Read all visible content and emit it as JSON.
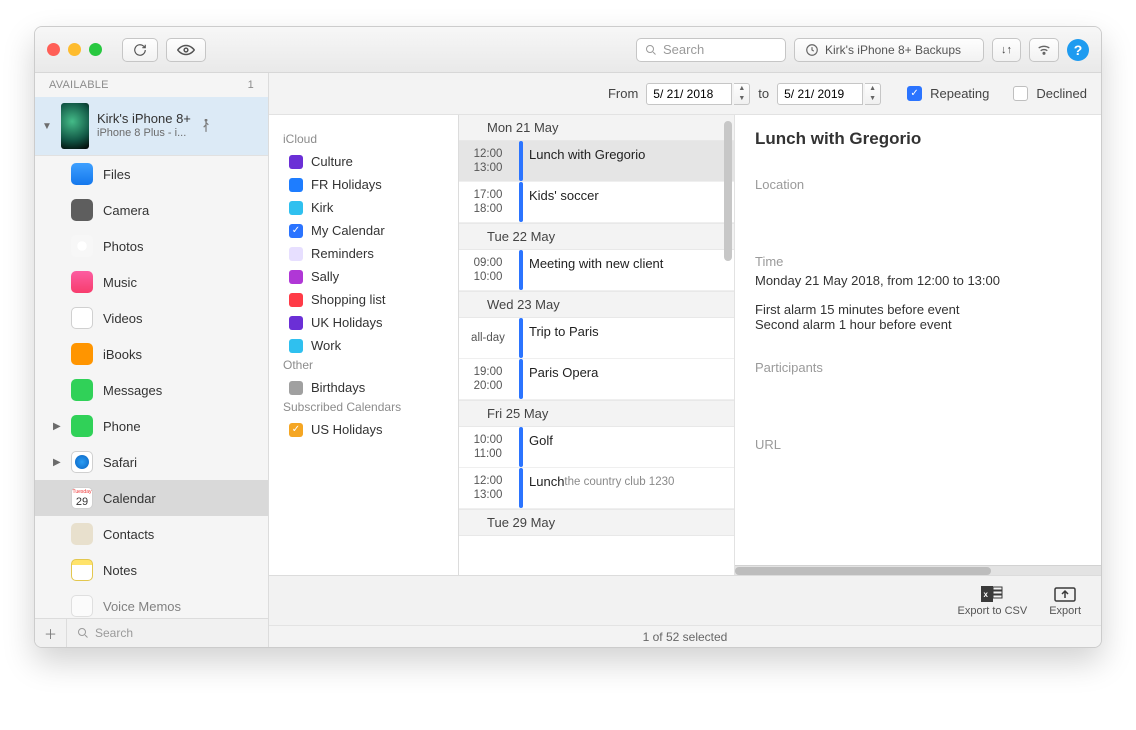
{
  "toolbar": {
    "search_placeholder": "Search",
    "backups_label": "Kirk's iPhone 8+ Backups"
  },
  "sidebar": {
    "header": "AVAILABLE",
    "header_count": "1",
    "device": {
      "name": "Kirk's iPhone 8+",
      "subtitle": "iPhone 8 Plus - i..."
    },
    "categories": [
      {
        "label": "Files"
      },
      {
        "label": "Camera"
      },
      {
        "label": "Photos"
      },
      {
        "label": "Music"
      },
      {
        "label": "Videos"
      },
      {
        "label": "iBooks"
      },
      {
        "label": "Messages"
      },
      {
        "label": "Phone"
      },
      {
        "label": "Safari"
      },
      {
        "label": "Calendar"
      },
      {
        "label": "Contacts"
      },
      {
        "label": "Notes"
      },
      {
        "label": "Voice Memos"
      }
    ],
    "search_placeholder": "Search"
  },
  "calendar_list": {
    "sections": [
      {
        "title": "iCloud",
        "items": [
          {
            "label": "Culture",
            "color": "#6b2fd6",
            "checked": false
          },
          {
            "label": "FR Holidays",
            "color": "#1e7dff",
            "checked": false
          },
          {
            "label": "Kirk",
            "color": "#2fc0ef",
            "checked": false
          },
          {
            "label": "My Calendar",
            "color": "#2b74ff",
            "checked": true
          },
          {
            "label": "Reminders",
            "color": "#e7dfff",
            "checked": false
          },
          {
            "label": "Sally",
            "color": "#b037d6",
            "checked": false
          },
          {
            "label": "Shopping list",
            "color": "#ff3b47",
            "checked": false
          },
          {
            "label": "UK Holidays",
            "color": "#6b2fd6",
            "checked": false
          },
          {
            "label": "Work",
            "color": "#2fc0ef",
            "checked": false
          }
        ]
      },
      {
        "title": "Other",
        "items": [
          {
            "label": "Birthdays",
            "color": "#a0a0a0",
            "checked": false
          }
        ]
      },
      {
        "title": "Subscribed Calendars",
        "items": [
          {
            "label": "US Holidays",
            "color": "#f5a623",
            "checked": true
          }
        ]
      }
    ]
  },
  "filter": {
    "from_label": "From",
    "from_value": "5/ 21/ 2018",
    "to_label": "to",
    "to_value": "5/ 21/ 2019",
    "repeating_label": "Repeating",
    "declined_label": "Declined"
  },
  "events": [
    {
      "day": "Mon 21 May"
    },
    {
      "start": "12:00",
      "end": "13:00",
      "title": "Lunch with Gregorio",
      "color": "#2b74ff",
      "selected": true
    },
    {
      "start": "17:00",
      "end": "18:00",
      "title": "Kids' soccer",
      "color": "#2b74ff"
    },
    {
      "day": "Tue 22 May"
    },
    {
      "start": "09:00",
      "end": "10:00",
      "title": "Meeting with new client",
      "color": "#2b74ff"
    },
    {
      "day": "Wed 23 May"
    },
    {
      "allday": "all-day",
      "title": "Trip to Paris",
      "color": "#2b74ff"
    },
    {
      "start": "19:00",
      "end": "20:00",
      "title": "Paris Opera",
      "color": "#2b74ff"
    },
    {
      "day": "Fri 25 May"
    },
    {
      "start": "10:00",
      "end": "11:00",
      "title": "Golf",
      "color": "#2b74ff"
    },
    {
      "start": "12:00",
      "end": "13:00",
      "title": "Lunch",
      "sub": "the country club 1230",
      "color": "#2b74ff"
    },
    {
      "day": "Tue 29 May"
    }
  ],
  "detail": {
    "title": "Lunch with Gregorio",
    "location_label": "Location",
    "time_label": "Time",
    "time_value": "Monday 21 May 2018, from 12:00 to 13:00",
    "alarm1": "First alarm 15 minutes before event",
    "alarm2": "Second alarm 1 hour before event",
    "participants_label": "Participants",
    "url_label": "URL"
  },
  "footer": {
    "export_csv": "Export to CSV",
    "export": "Export"
  },
  "status": "1 of 52 selected"
}
